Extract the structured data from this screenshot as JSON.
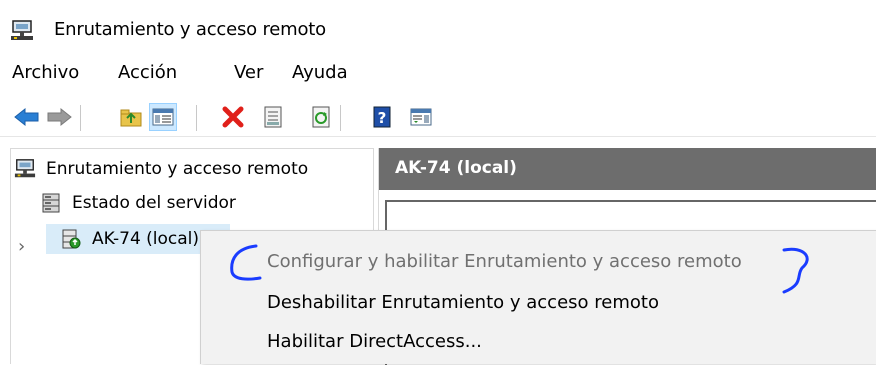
{
  "window": {
    "title": "Enrutamiento y acceso remoto",
    "icon": "routing-server-icon"
  },
  "menu": {
    "items": [
      "Archivo",
      "Acción",
      "Ver",
      "Ayuda"
    ]
  },
  "toolbar": {
    "buttons": [
      "back-arrow-icon",
      "forward-arrow-icon",
      "up-folder-icon",
      "show-hide-console-tree-icon",
      "delete-icon",
      "properties-icon",
      "refresh-icon",
      "help-icon",
      "action-pane-icon"
    ]
  },
  "tree": {
    "root_label": "Enrutamiento y acceso remoto",
    "status_label": "Estado del servidor",
    "server_label": "AK-74 (local)",
    "expander": "›"
  },
  "details": {
    "header": "AK-74 (local)"
  },
  "context_menu": {
    "items": [
      {
        "label": "Configurar y habilitar Enrutamiento y acceso remoto",
        "enabled": false
      },
      {
        "label": "Deshabilitar Enrutamiento y acceso remoto",
        "enabled": true
      },
      {
        "label": "Habilitar DirectAccess...",
        "enabled": true
      }
    ]
  },
  "colors": {
    "annotation": "#1a3cff",
    "header_bg": "#6d6d6d",
    "selection": "#d9ecf9",
    "menu_bg": "#f2f2f2"
  }
}
